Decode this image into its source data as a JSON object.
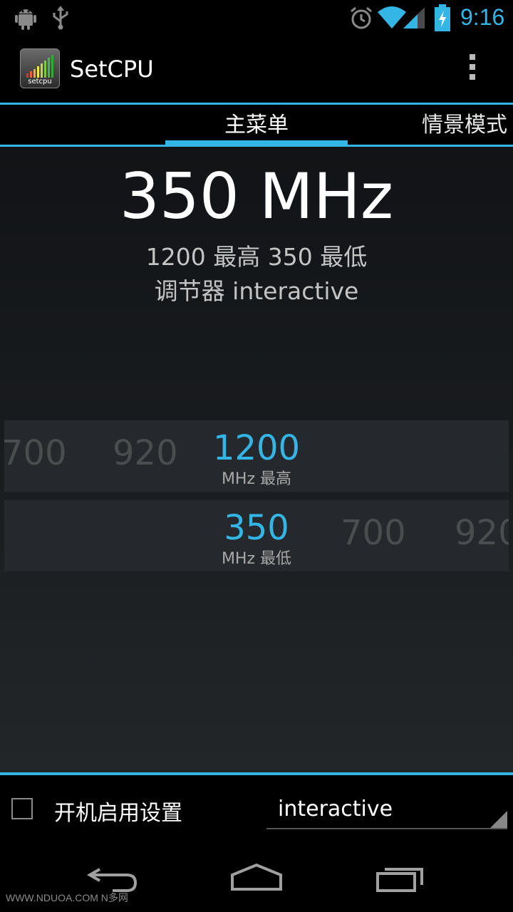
{
  "status_bar": {
    "time": "9:16",
    "left_icons": [
      "android-icon",
      "usb-icon"
    ],
    "right_icons": [
      "alarm-icon",
      "wifi-icon",
      "signal-icon",
      "battery-charging-icon"
    ]
  },
  "action_bar": {
    "title": "SetCPU",
    "app_icon_text": "setcpu"
  },
  "tabs": [
    {
      "label": "主菜单",
      "selected": true
    },
    {
      "label": "情景模式",
      "selected": false
    }
  ],
  "main": {
    "current_freq": "350 MHz",
    "max_min_line": "1200 最高 350 最低",
    "governor_line": "调节器 interactive"
  },
  "max_picker": {
    "left_values": [
      "700",
      "920"
    ],
    "selected": "1200",
    "unit": "MHz 最高"
  },
  "min_picker": {
    "selected": "350",
    "unit": "MHz 最低",
    "right_values": [
      "700",
      "920"
    ]
  },
  "bottom": {
    "set_on_boot_label": "开机启用设置",
    "set_on_boot_checked": false,
    "governor_selected": "interactive"
  },
  "nav_bar": {
    "buttons": [
      "back-icon",
      "home-icon",
      "recent-apps-icon"
    ]
  },
  "watermark": "WWW.NDUOA.COM N多网",
  "colors": {
    "accent": "#33b5e5",
    "background": "#000000"
  }
}
